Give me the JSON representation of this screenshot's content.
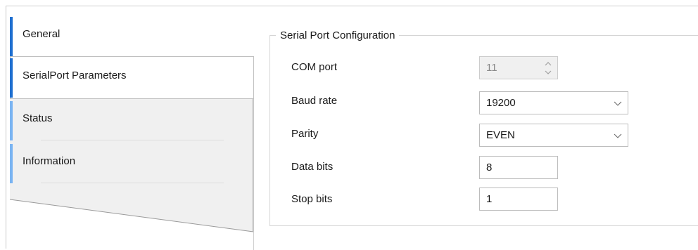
{
  "sidebar": {
    "items": [
      {
        "label": "General"
      },
      {
        "label": "SerialPort Parameters"
      },
      {
        "label": "Status"
      },
      {
        "label": "Information"
      }
    ]
  },
  "group": {
    "title": "Serial Port Configuration",
    "fields": [
      {
        "label": "COM port",
        "value": "11"
      },
      {
        "label": "Baud rate",
        "value": "19200"
      },
      {
        "label": "Parity",
        "value": "EVEN"
      },
      {
        "label": "Data bits",
        "value": "8"
      },
      {
        "label": "Stop bits",
        "value": "1"
      }
    ]
  },
  "colors": {
    "accent": "#1f6fd0",
    "accent_light": "#7ab4f2",
    "panel_gray": "#f0f0f0"
  },
  "icons": {
    "spinner": "spin-updown-icon",
    "dropdown": "chevron-down-icon"
  }
}
